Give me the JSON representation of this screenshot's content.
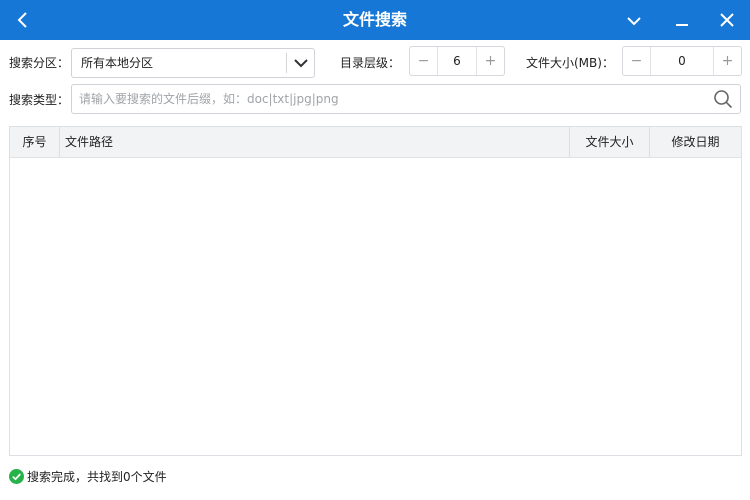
{
  "window": {
    "title": "文件搜索"
  },
  "filters": {
    "partition_label": "搜索分区：",
    "partition_value": "所有本地分区",
    "depth_label": "目录层级：",
    "depth_value": "6",
    "size_label": "文件大小(MB)：",
    "size_value": "0",
    "type_label": "搜索类型：",
    "type_placeholder": "请输入要搜索的文件后缀，如：doc|txt|jpg|png"
  },
  "table": {
    "columns": [
      "序号",
      "文件路径",
      "文件大小",
      "修改日期"
    ],
    "rows": []
  },
  "status": {
    "text": "搜索完成，共找到0个文件"
  },
  "colors": {
    "titlebar": "#1677d6",
    "status_ok": "#27b24a"
  }
}
